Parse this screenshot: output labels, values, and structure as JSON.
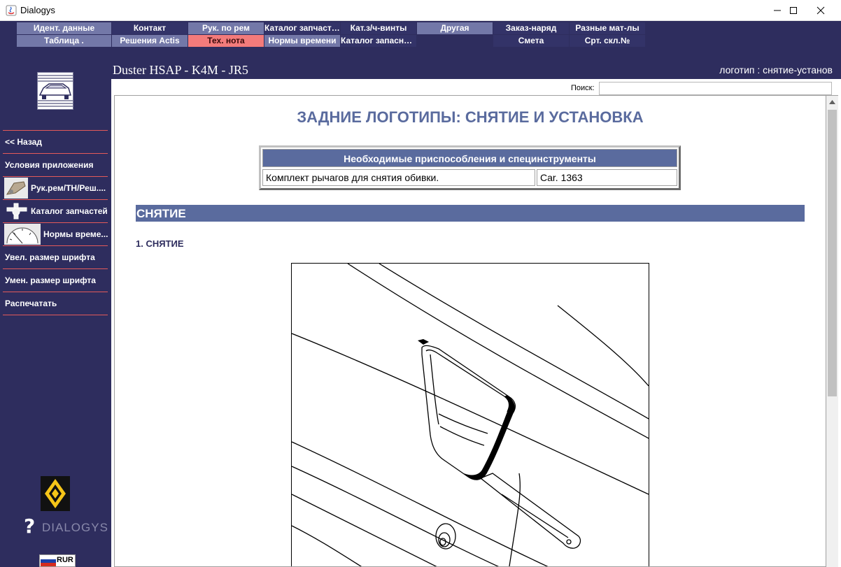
{
  "window": {
    "title": "Dialogys"
  },
  "top_menu": {
    "row1": [
      "Идент. данные",
      "Контакт",
      "Рук. по рем",
      "Каталог запчастей",
      "Кат.з/ч-винты",
      "Другая",
      "Заказ-наряд",
      "Разные мат-лы"
    ],
    "row2": [
      "Таблица .",
      "Решения Actis",
      "Тех. нота",
      "Нормы времени",
      "Каталог запасны...",
      "",
      "Смета",
      "Срт. скл.№"
    ],
    "active_item": "Тех. нота"
  },
  "header": {
    "vehicle": "Duster HSAP - K4M - JR5",
    "breadcrumb": "логотип : снятие-установ"
  },
  "sidebar": {
    "items": [
      {
        "label": "<< Назад",
        "icon": null
      },
      {
        "label": "Условия приложения",
        "icon": null
      },
      {
        "label": "Рук.рем/ТН/Реш....",
        "icon": "repair-manual-icon"
      },
      {
        "label": "Каталог запчастей",
        "icon": "parts-catalog-icon"
      },
      {
        "label": "Нормы време...",
        "icon": "time-norms-icon"
      },
      {
        "label": "Увел. размер шрифта",
        "icon": null
      },
      {
        "label": "Умен. размер шрифта",
        "icon": null
      },
      {
        "label": "Распечатать",
        "icon": null
      }
    ],
    "brand": "DIALOGYS",
    "currency": "RUR"
  },
  "search": {
    "label": "Поиск:",
    "value": ""
  },
  "document": {
    "title": "ЗАДНИЕ ЛОГОТИПЫ: СНЯТИЕ И УСТАНОВКА",
    "tools_table": {
      "header": "Необходимые приспособления и специнструменты",
      "rows": [
        [
          "Комплект рычагов для снятия обивки.",
          "Car. 1363"
        ]
      ]
    },
    "section": "СНЯТИЕ",
    "step": "1. СНЯТИЕ"
  },
  "colors": {
    "app_bg": "#2e2d5e",
    "menu_light": "#7378a8",
    "menu_active": "#f37b7b",
    "heading_blue": "#5a6b9e",
    "separator_red": "#e35a5a"
  }
}
